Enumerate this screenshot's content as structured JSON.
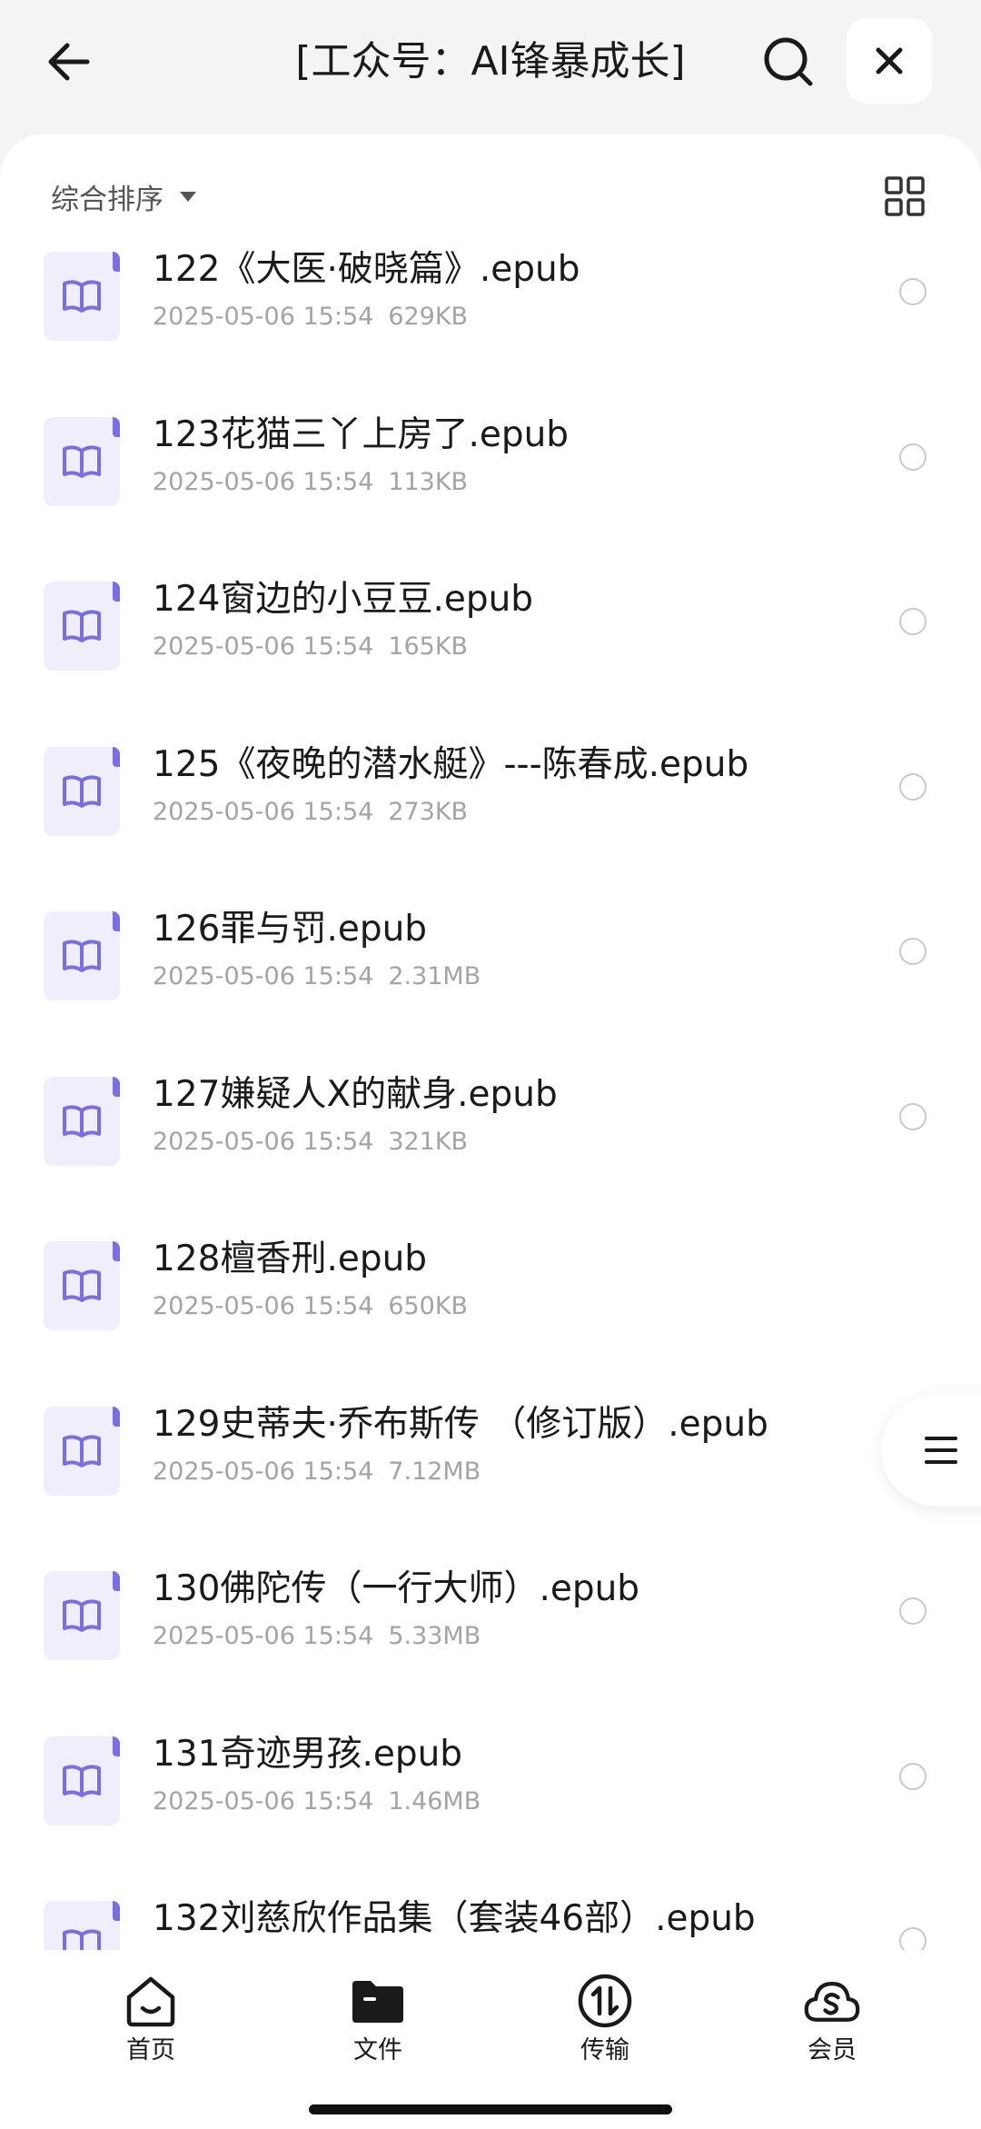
{
  "header": {
    "title": "[工众号：AI锋暴成长]",
    "back_icon": "arrow-left-icon",
    "search_icon": "search-icon",
    "close_icon": "close-icon"
  },
  "sort": {
    "label": "综合排序",
    "view_icon": "grid-view-icon"
  },
  "files": [
    {
      "name": "122《大医·破晓篇》.epub",
      "date": "2025-05-06 15:54",
      "size": "629KB"
    },
    {
      "name": "123花猫三丫上房了.epub",
      "date": "2025-05-06 15:54",
      "size": "113KB"
    },
    {
      "name": "124窗边的小豆豆.epub",
      "date": "2025-05-06 15:54",
      "size": "165KB"
    },
    {
      "name": "125《夜晚的潜水艇》---陈春成.epub",
      "date": "2025-05-06 15:54",
      "size": "273KB"
    },
    {
      "name": "126罪与罚.epub",
      "date": "2025-05-06 15:54",
      "size": "2.31MB"
    },
    {
      "name": "127嫌疑人X的献身.epub",
      "date": "2025-05-06 15:54",
      "size": "321KB"
    },
    {
      "name": "128檀香刑.epub",
      "date": "2025-05-06 15:54",
      "size": "650KB"
    },
    {
      "name": "129史蒂夫·乔布斯传 （修订版）.epub",
      "date": "2025-05-06 15:54",
      "size": "7.12MB"
    },
    {
      "name": "130佛陀传（一行大师）.epub",
      "date": "2025-05-06 15:54",
      "size": "5.33MB"
    },
    {
      "name": "131奇迹男孩.epub",
      "date": "2025-05-06 15:54",
      "size": "1.46MB"
    },
    {
      "name": "132刘慈欣作品集（套装46部）.epub",
      "date": "",
      "size": ""
    }
  ],
  "tabs": [
    {
      "label": "首页",
      "icon": "home-icon"
    },
    {
      "label": "文件",
      "icon": "folder-icon"
    },
    {
      "label": "传输",
      "icon": "transfer-icon"
    },
    {
      "label": "会员",
      "icon": "cloud-vip-icon"
    }
  ],
  "colors": {
    "accent": "#7a6ee0",
    "icon_bg": "#efeefa",
    "meta_text": "#a3a3a8"
  }
}
